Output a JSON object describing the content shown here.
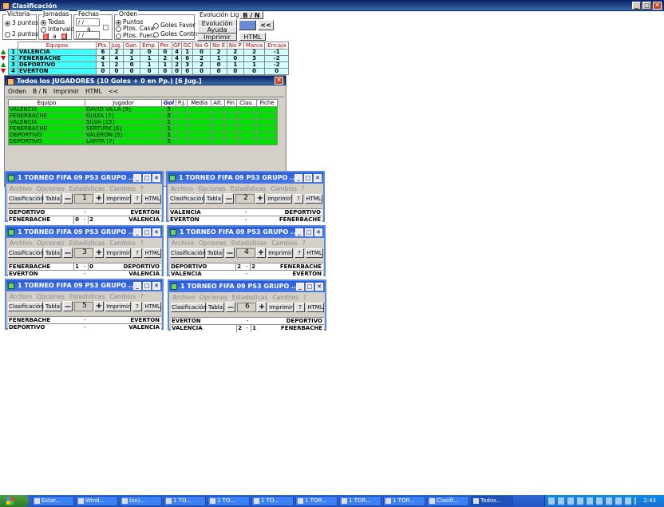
{
  "main": {
    "title": "Clasificación",
    "victoria": {
      "label": "Victoria",
      "opt1": "3 puntos",
      "opt2": "2 puntos"
    },
    "jornadas": {
      "label": "Jornadas",
      "opt1": "Todas",
      "opt2": "Intervalo",
      "from": "1",
      "a": "a",
      "to": "4"
    },
    "fechas": {
      "label": "Fechas",
      "date1": " /  /",
      "a": "a",
      "date2": " /  /"
    },
    "orden": {
      "label": "Orden",
      "opt1": "Puntos",
      "opt2": "Ptos. Casa",
      "opt3": "Ptos. Fuera",
      "opt4": "Goles Favor",
      "opt5": "Goles Contra"
    },
    "evol_label": "Evolución Liga",
    "bn": "B / N",
    "btn_evolucion": "Evolución",
    "btn_ayuda": "Ayuda",
    "btn_imprimir": "Imprimir",
    "btn_html": "HTML",
    "btn_back": "<<",
    "table_headers": [
      "Equipos",
      "Pts.",
      "Jug.",
      "Gan.",
      "Emp.",
      "Per.",
      "GF",
      "GC",
      "No G",
      "No E",
      "No P",
      "Marca",
      "Encaja"
    ],
    "rows": [
      {
        "pos": "1",
        "team": "VALENCIA",
        "vals": [
          "6",
          "2",
          "2",
          "0",
          "0",
          "4",
          "1",
          "0",
          "2",
          "2",
          "2",
          "-1"
        ]
      },
      {
        "pos": "2",
        "team": "FENERBACHE",
        "vals": [
          "4",
          "4",
          "1",
          "1",
          "2",
          "4",
          "6",
          "2",
          "1",
          "0",
          "3",
          "-2"
        ]
      },
      {
        "pos": "3",
        "team": "DEPORTIVO",
        "vals": [
          "1",
          "2",
          "0",
          "1",
          "1",
          "2",
          "3",
          "2",
          "0",
          "1",
          "1",
          "-2"
        ]
      },
      {
        "pos": "4",
        "team": "EVERTON",
        "vals": [
          "0",
          "0",
          "0",
          "0",
          "0",
          "0",
          "0",
          "0",
          "0",
          "0",
          "0",
          "0"
        ]
      }
    ]
  },
  "players": {
    "title": "Todos los JUGADORES (10 Goles + 0 en Pp.) [6 Jug.]",
    "menu": [
      "Orden",
      "B / N",
      "Imprimir",
      "HTML",
      "<<"
    ],
    "headers": [
      "Equipo",
      "Jugador",
      "Gol",
      "P.J.",
      "Media",
      "Alt.",
      "Fin",
      "Clau.",
      "Fiche"
    ],
    "rows": [
      {
        "team": "VALENCIA",
        "player": "DAVID VILLA [9]",
        "gol": "3"
      },
      {
        "team": "FENERBACHE",
        "player": "GUIZA [7]",
        "gol": "3"
      },
      {
        "team": "VALENCIA",
        "player": "SILVA [15]",
        "gol": "1"
      },
      {
        "team": "FENERBACHE",
        "player": "SERTURK [6]",
        "gol": "1"
      },
      {
        "team": "DEPORTIVO",
        "player": "VALERON [5]",
        "gol": "1"
      },
      {
        "team": "DEPORTIVO",
        "player": "LAFITA [7]",
        "gol": "1"
      }
    ]
  },
  "mini_common": {
    "title": "1 TORNEO FIFA 09 PS3  GRUPO ...",
    "menu": [
      "Archivo",
      "Opciones",
      "Estadísticas",
      "Cambios",
      "?"
    ],
    "clasif": "Clasificación",
    "tabla": "Tabla",
    "minus": "—",
    "plus": "+",
    "imprimir": "Imprimir",
    "help": "?",
    "html": "HTML"
  },
  "jornadas": [
    {
      "num": "1",
      "matches": [
        {
          "home": "DEPORTIVO",
          "hs": "",
          "as": "",
          "away": "EVERTON"
        },
        {
          "home": "FENERBACHE",
          "hs": "0",
          "as": "2",
          "away": "VALENCIA"
        }
      ]
    },
    {
      "num": "2",
      "matches": [
        {
          "home": "VALENCIA",
          "hs": "",
          "as": "",
          "away": "DEPORTIVO"
        },
        {
          "home": "EVERTON",
          "hs": "",
          "as": "",
          "away": "FENERBACHE"
        }
      ]
    },
    {
      "num": "3",
      "matches": [
        {
          "home": "FENERBACHE",
          "hs": "1",
          "as": "0",
          "away": "DEPORTIVO"
        },
        {
          "home": "EVERTON",
          "hs": "",
          "as": "",
          "away": "VALENCIA"
        }
      ]
    },
    {
      "num": "4",
      "matches": [
        {
          "home": "DEPORTIVO",
          "hs": "2",
          "as": "2",
          "away": "FENERBACHE"
        },
        {
          "home": "VALENCIA",
          "hs": "",
          "as": "",
          "away": "EVERTON"
        }
      ]
    },
    {
      "num": "5",
      "matches": [
        {
          "home": "FENERBACHE",
          "hs": "",
          "as": "",
          "away": "EVERTON"
        },
        {
          "home": "DEPORTIVO",
          "hs": "",
          "as": "",
          "away": "VALENCIA"
        }
      ]
    },
    {
      "num": "6",
      "matches": [
        {
          "home": "EVERTON",
          "hs": "",
          "as": "",
          "away": "DEPORTIVO"
        },
        {
          "home": "VALENCIA",
          "hs": "2",
          "as": "1",
          "away": "FENERBACHE"
        }
      ]
    }
  ],
  "taskbar": {
    "items": [
      "Estar...",
      "Wind...",
      "(so)...",
      "1 TO...",
      "1 TO...",
      "1 TO...",
      "1 TOR...",
      "1 TOR...",
      "1 TOR...",
      "Clasifi...",
      "Todos..."
    ],
    "clock": "2:43"
  }
}
